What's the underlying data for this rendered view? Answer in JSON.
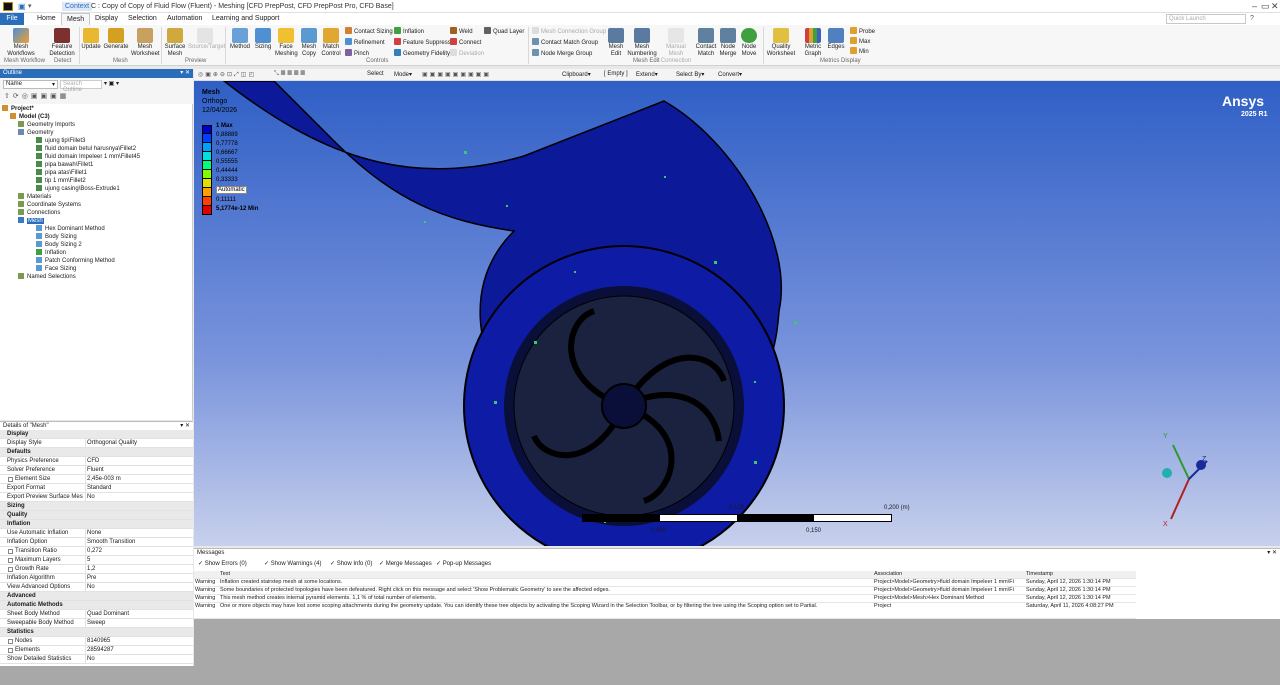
{
  "titlebar": {
    "context": "Context",
    "title": "C : Copy of Copy of Fluid Flow (Fluent) - Meshing [CFD PrepPost, CFD PrepPost Pro, CFD Base]",
    "controls": [
      "–",
      "▭",
      "✕"
    ]
  },
  "tabs": [
    "File",
    "Home",
    "Mesh",
    "Display",
    "Selection",
    "Automation",
    "Learning and Support"
  ],
  "active_tab": "Mesh",
  "quick_launch_placeholder": "Quick Launch",
  "ribbon": {
    "mesh_workflows": "Mesh Workflows",
    "feature_detection": "Feature Detection",
    "update": "Update",
    "generate": "Generate",
    "mesh_worksheet": "Mesh Worksheet",
    "surface_mesh": "Surface Mesh",
    "source_target": "Source/Target",
    "method": "Method",
    "sizing": "Sizing",
    "face_meshing": "Face Meshing",
    "mesh_copy": "Mesh Copy",
    "match_control": "Match Control",
    "contact_sizing": "Contact Sizing",
    "refinement": "Refinement",
    "pinch": "Pinch",
    "inflation": "Inflation",
    "feature_suppress": "Feature Suppress",
    "geometry_fidelity": "Geometry Fidelity",
    "weld": "Weld",
    "connect": "Connect",
    "deviation": "Deviation",
    "quad_layer": "Quad Layer",
    "mesh_connection_group": "Mesh Connection Group",
    "contact_match_group": "Contact Match Group",
    "node_merge_group": "Node Merge Group",
    "mesh_edit": "Mesh Edit",
    "mesh_numbering": "Mesh Numbering",
    "manual_mesh_connection": "Manual Mesh Connection",
    "contact_match": "Contact Match",
    "node_merge": "Node Merge",
    "node_move": "Node Move",
    "quality_worksheet": "Quality Worksheet",
    "metric_graph": "Metric Graph",
    "edges": "Edges",
    "probe": "Probe",
    "max": "Max",
    "min": "Min",
    "groups": [
      "Mesh Workflow",
      "Detect",
      "Mesh",
      "Preview",
      "Controls",
      "Mesh Edit",
      "Metrics Display"
    ]
  },
  "outline": {
    "title": "Outline",
    "filter_name": "Name",
    "search_placeholder": "Search Outline",
    "tree": [
      {
        "label": "Project*",
        "level": 0,
        "bold": true
      },
      {
        "label": "Model (C3)",
        "level": 1,
        "bold": true
      },
      {
        "label": "Geometry Imports",
        "level": 2
      },
      {
        "label": "Geometry",
        "level": 2
      },
      {
        "label": "ujung tip\\Fillet3",
        "level": 3
      },
      {
        "label": "fluid domain betul harusnya\\Fillet2",
        "level": 3
      },
      {
        "label": "fluid domain Impeleer 1 mm\\Fillet45",
        "level": 3
      },
      {
        "label": "pipa bawah\\Fillet1",
        "level": 3
      },
      {
        "label": "pipa atas\\Fillet1",
        "level": 3
      },
      {
        "label": "tip 1 mm\\Fillet2",
        "level": 3
      },
      {
        "label": "ujung casing\\Boss-Extrude1",
        "level": 3
      },
      {
        "label": "Materials",
        "level": 2
      },
      {
        "label": "Coordinate Systems",
        "level": 2
      },
      {
        "label": "Connections",
        "level": 2
      },
      {
        "label": "Mesh",
        "level": 2,
        "selected": true
      },
      {
        "label": "Hex Dominant Method",
        "level": 3
      },
      {
        "label": "Body Sizing",
        "level": 3
      },
      {
        "label": "Body Sizing 2",
        "level": 3
      },
      {
        "label": "Inflation",
        "level": 3
      },
      {
        "label": "Patch Conforming Method",
        "level": 3
      },
      {
        "label": "Face Sizing",
        "level": 3
      },
      {
        "label": "Named Selections",
        "level": 2
      }
    ]
  },
  "details": {
    "title": "Details of \"Mesh\"",
    "rows": [
      {
        "type": "sec",
        "k": "Display"
      },
      {
        "k": "Display Style",
        "v": "Orthogonal Quality"
      },
      {
        "type": "sec",
        "k": "Defaults"
      },
      {
        "k": "Physics Preference",
        "v": "CFD"
      },
      {
        "k": "Solver Preference",
        "v": "Fluent"
      },
      {
        "k": "Element Size",
        "v": "2,45e-003 m",
        "cb": true
      },
      {
        "k": "Export Format",
        "v": "Standard"
      },
      {
        "k": "Export Preview Surface Mesh",
        "v": "No"
      },
      {
        "type": "sec",
        "k": "Sizing"
      },
      {
        "type": "sec",
        "k": "Quality"
      },
      {
        "type": "sec",
        "k": "Inflation"
      },
      {
        "k": "Use Automatic Inflation",
        "v": "None"
      },
      {
        "k": "Inflation Option",
        "v": "Smooth Transition"
      },
      {
        "k": "Transition Ratio",
        "v": "0,272",
        "cb": true
      },
      {
        "k": "Maximum Layers",
        "v": "5",
        "cb": true
      },
      {
        "k": "Growth Rate",
        "v": "1,2",
        "cb": true
      },
      {
        "k": "Inflation Algorithm",
        "v": "Pre"
      },
      {
        "k": "View Advanced Options",
        "v": "No"
      },
      {
        "type": "sec",
        "k": "Advanced"
      },
      {
        "type": "sec",
        "k": "Automatic Methods"
      },
      {
        "k": "Sheet Body Method",
        "v": "Quad Dominant"
      },
      {
        "k": "Sweepable Body Method",
        "v": "Sweep"
      },
      {
        "type": "sec",
        "k": "Statistics"
      },
      {
        "k": "Nodes",
        "v": "8140965",
        "cb": true
      },
      {
        "k": "Elements",
        "v": "28594287",
        "cb": true
      },
      {
        "k": "Show Detailed Statistics",
        "v": "No"
      }
    ]
  },
  "viewtoolbar": {
    "select": "Select",
    "mode": "Mode",
    "clipboard": "Clipboard",
    "empty": "[ Empty ]",
    "extend": "Extend",
    "select_by": "Select By",
    "convert": "Convert"
  },
  "viewport": {
    "header": "Mesh",
    "sub1": "Orthogo",
    "date": "12/04/2026",
    "brand": "Ansys",
    "version": "2025 R1",
    "legend": [
      "1 Max",
      "0,88889",
      "0,77778",
      "0,66667",
      "0,55555",
      "0,44444",
      "0,33333",
      "Automatic",
      "0,11111",
      "5,1774e-12 Min"
    ],
    "legend_colors": [
      "#0000c8",
      "#0040ff",
      "#00a0ff",
      "#00e0e0",
      "#00ff80",
      "#80ff00",
      "#e0e000",
      "#ffa000",
      "#ff4000",
      "#e00000"
    ],
    "scale_labels": [
      "0,100",
      "0,200 (m)",
      "0,050",
      "0,150"
    ],
    "triad": {
      "x": "X",
      "y": "Y",
      "z": "Z"
    }
  },
  "messages": {
    "title": "Messages",
    "filters": [
      "Show Errors  (0)",
      "Show Warnings  (4)",
      "Show Info  (0)",
      "Merge Messages",
      "Pop-up Messages"
    ],
    "columns": [
      "Text",
      "Association",
      "Timestamp"
    ],
    "rows": [
      {
        "type": "Warning",
        "text": "Inflation created stairstep mesh at some locations.",
        "assoc": "Project>Model>Geometry>fluid domain Impeleer 1 mm\\Fi",
        "time": "Sunday, April 12, 2026 1:30:14 PM"
      },
      {
        "type": "Warning",
        "text": "Some boundaries of protected topologies have been defeatured.  Right click on this message and select 'Show Problematic Geometry' to see the affected edges.",
        "assoc": "Project>Model>Geometry>fluid domain Impeleer 1 mm\\Fi",
        "time": "Sunday, April 12, 2026 1:30:14 PM"
      },
      {
        "type": "Warning",
        "text": "This mesh method creates internal pyramid elements. 1,1 % of total number of elements.",
        "assoc": "Project>Model>Mesh>Hex Dominant Method",
        "time": "Sunday, April 12, 2026 1:30:14 PM"
      },
      {
        "type": "Warning",
        "text": "One or more objects may have lost some scoping attachments during the geometry update. You can identify these tree objects by activating the Scoping Wizard in the Selection Toolbar, or by filtering the tree using the Scoping option set to Partial.",
        "assoc": "Project",
        "time": "Saturday, April 11, 2026 4:08:27 PM"
      }
    ]
  }
}
